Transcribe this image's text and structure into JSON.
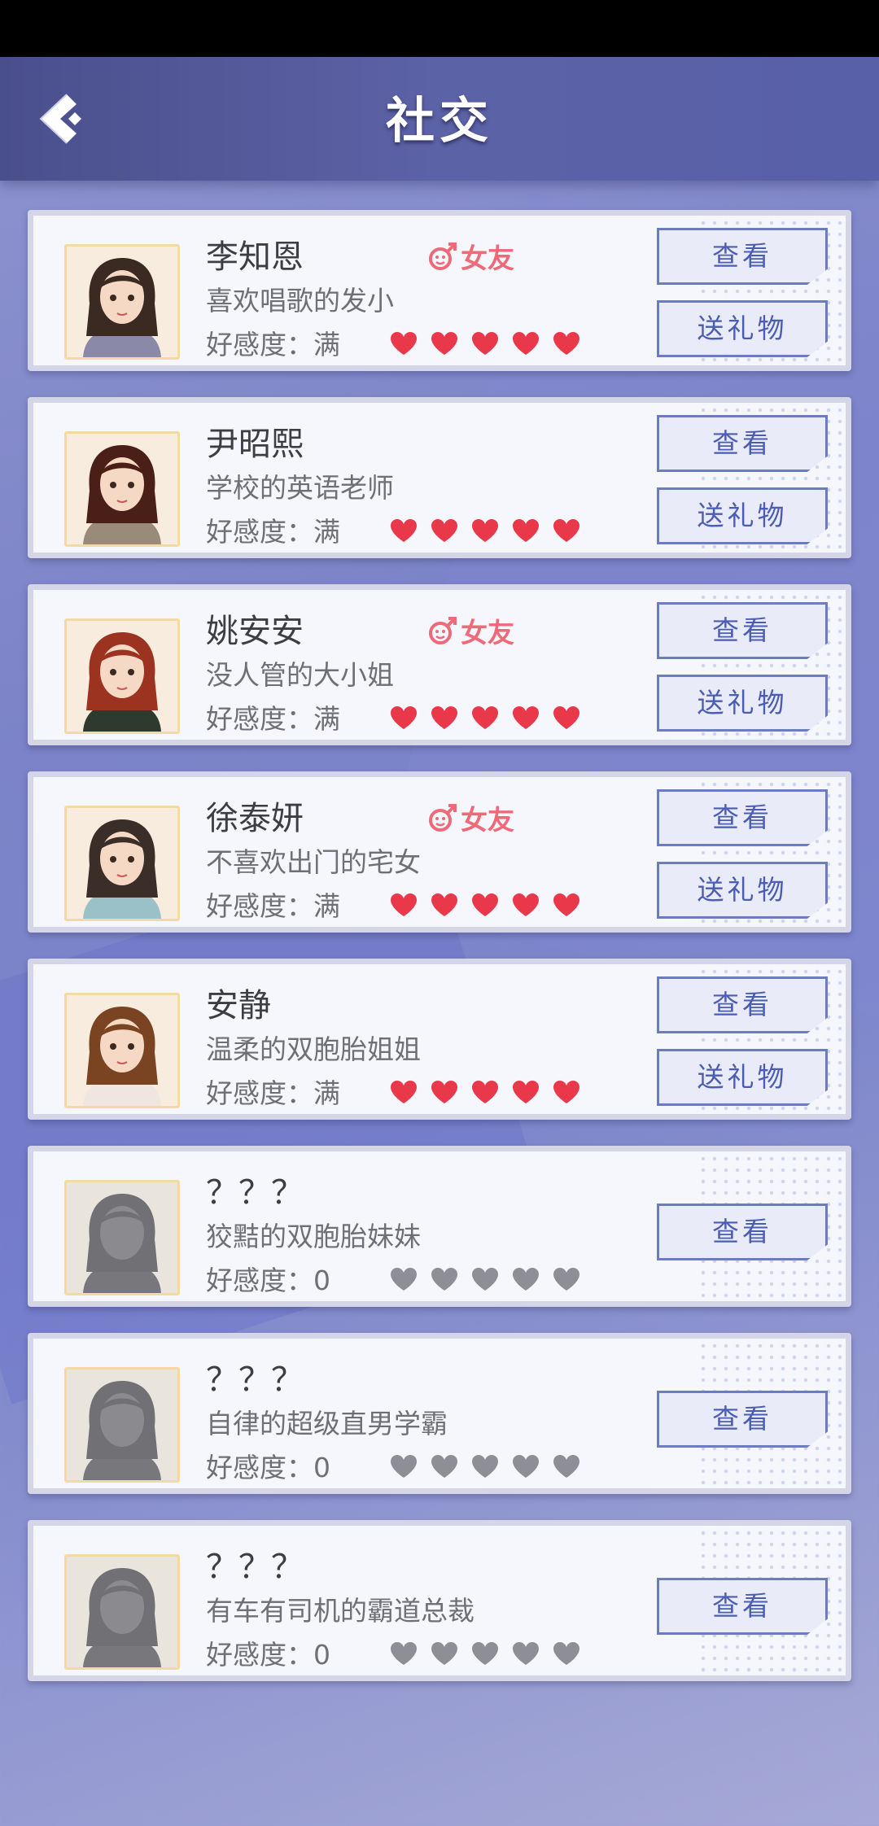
{
  "header": {
    "title": "社交"
  },
  "labels": {
    "view": "查看",
    "gift": "送礼物"
  },
  "colors": {
    "heart_full": "#e8384a",
    "heart_empty": "#8e8e96",
    "tag": "#ef6a78"
  },
  "characters": [
    {
      "name": "李知恩",
      "tag": "女友",
      "desc": "喜欢唱歌的发小",
      "affinity": "好感度：满",
      "hearts_filled": 5,
      "hearts_total": 5,
      "locked": false
    },
    {
      "name": "尹昭熙",
      "tag": "",
      "desc": "学校的英语老师",
      "affinity": "好感度：满",
      "hearts_filled": 5,
      "hearts_total": 5,
      "locked": false
    },
    {
      "name": "姚安安",
      "tag": "女友",
      "desc": "没人管的大小姐",
      "affinity": "好感度：满",
      "hearts_filled": 5,
      "hearts_total": 5,
      "locked": false
    },
    {
      "name": "徐泰妍",
      "tag": "女友",
      "desc": "不喜欢出门的宅女",
      "affinity": "好感度：满",
      "hearts_filled": 5,
      "hearts_total": 5,
      "locked": false
    },
    {
      "name": "安静",
      "tag": "",
      "desc": "温柔的双胞胎姐姐",
      "affinity": "好感度：满",
      "hearts_filled": 5,
      "hearts_total": 5,
      "locked": false
    },
    {
      "name": "？？？",
      "tag": "",
      "desc": "狡黠的双胞胎妹妹",
      "affinity": "好感度：0",
      "hearts_filled": 0,
      "hearts_total": 5,
      "locked": true
    },
    {
      "name": "？？？",
      "tag": "",
      "desc": "自律的超级直男学霸",
      "affinity": "好感度：0",
      "hearts_filled": 0,
      "hearts_total": 5,
      "locked": true
    },
    {
      "name": "？？？",
      "tag": "",
      "desc": "有车有司机的霸道总裁",
      "affinity": "好感度：0",
      "hearts_filled": 0,
      "hearts_total": 5,
      "locked": true
    }
  ]
}
